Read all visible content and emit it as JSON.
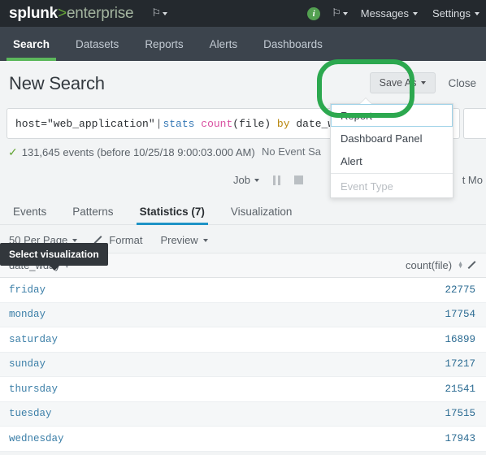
{
  "topbar": {
    "logo_part1": "splunk",
    "logo_part2": ">",
    "logo_part3": "enterprise",
    "app_flag_icon": "flag-icon",
    "info_badge": "i",
    "messages_label": "Messages",
    "settings_label": "Settings",
    "accent_green": "#65a637",
    "bar_bg": "#24292e"
  },
  "nav": {
    "items": [
      {
        "label": "Search",
        "active": true
      },
      {
        "label": "Datasets",
        "active": false
      },
      {
        "label": "Reports",
        "active": false
      },
      {
        "label": "Alerts",
        "active": false
      },
      {
        "label": "Dashboards",
        "active": false
      }
    ],
    "bar_bg": "#3c444d",
    "active_underline": "#5cb85c"
  },
  "page": {
    "title": "New Search",
    "save_as_label": "Save As",
    "close_label": "Close"
  },
  "save_as_menu": {
    "items": [
      {
        "label": "Report",
        "state": "hovered"
      },
      {
        "label": "Dashboard Panel",
        "state": "normal"
      },
      {
        "label": "Alert",
        "state": "normal"
      },
      {
        "label": "Event Type",
        "state": "disabled"
      }
    ],
    "highlight_color": "#2ca84f"
  },
  "search": {
    "query_tokens": [
      {
        "text": "host=\"web_application\"",
        "type": "plain"
      },
      {
        "text": "|",
        "type": "pipe"
      },
      {
        "text": "stats",
        "type": "command"
      },
      {
        "text": "count",
        "type": "function"
      },
      {
        "text": "(file)",
        "type": "plain"
      },
      {
        "text": "by",
        "type": "keyword"
      },
      {
        "text": "date_wday",
        "type": "plain"
      }
    ],
    "query_full": "host=\"web_application\" | stats count(file) by date_wday"
  },
  "status": {
    "check_icon": "check-icon",
    "events_text": "131,645 events (before 10/25/18 9:00:03.000 AM)",
    "sampling_label": "No Event Sa",
    "job_label": "Job",
    "pause_icon": "pause-icon",
    "stop_icon": "stop-icon",
    "mode_label": "t Mo"
  },
  "tooltip": {
    "text": "Select visualization"
  },
  "result_tabs": [
    {
      "label": "Events",
      "active": false
    },
    {
      "label": "Patterns",
      "active": false
    },
    {
      "label": "Statistics (7)",
      "active": true
    },
    {
      "label": "Visualization",
      "active": false
    }
  ],
  "table_controls": {
    "per_page_label": "50 Per Page",
    "format_label": "Format",
    "format_icon": "pencil-icon",
    "preview_label": "Preview"
  },
  "results_table": {
    "columns": [
      {
        "label": "date_wday",
        "sortable": true
      },
      {
        "label": "count(file)",
        "sortable": true
      }
    ],
    "edit_icon": "pencil-icon",
    "rows": [
      {
        "date_wday": "friday",
        "count": "22775"
      },
      {
        "date_wday": "monday",
        "count": "17754"
      },
      {
        "date_wday": "saturday",
        "count": "16899"
      },
      {
        "date_wday": "sunday",
        "count": "17217"
      },
      {
        "date_wday": "thursday",
        "count": "21541"
      },
      {
        "date_wday": "tuesday",
        "count": "17515"
      },
      {
        "date_wday": "wednesday",
        "count": "17943"
      }
    ]
  }
}
